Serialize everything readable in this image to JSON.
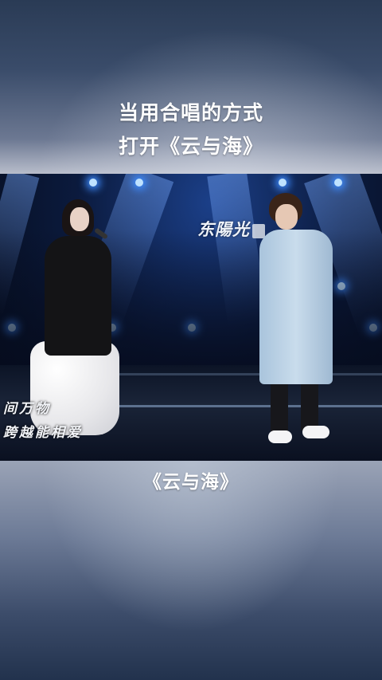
{
  "headline": {
    "line1": "当用合唱的方式",
    "line2": "打开《云与海》"
  },
  "video": {
    "stage_logo": "东陽光",
    "lyrics": [
      "间万物",
      "跨越能相爱"
    ]
  },
  "caption": {
    "song_title": "《云与海》"
  },
  "colors": {
    "text": "#ffffff",
    "stage_blue": "#1b3f88",
    "coat_blue": "#c9dcec"
  }
}
